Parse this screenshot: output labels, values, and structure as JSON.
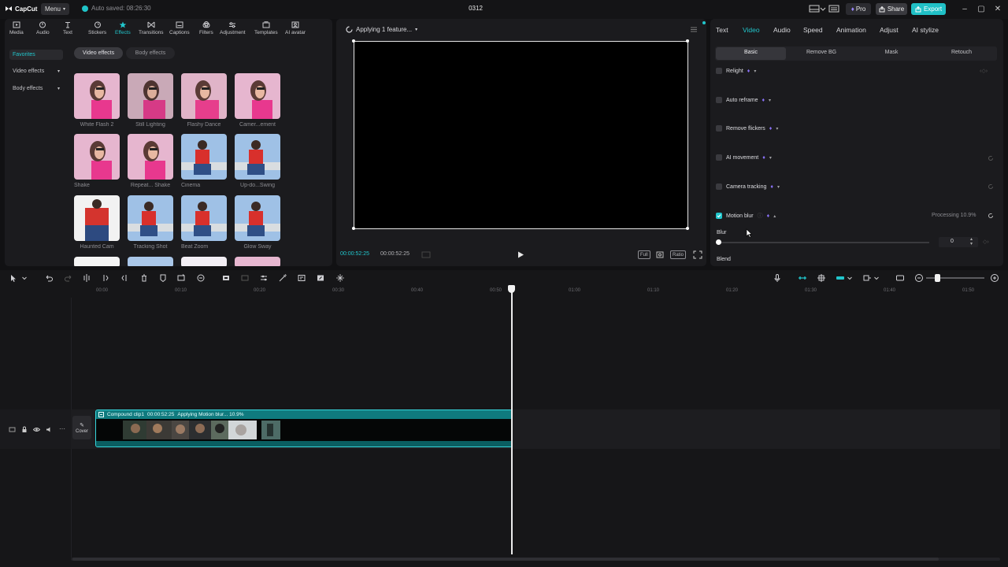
{
  "app": {
    "logo_text": "CapCut",
    "menu_label": "Menu",
    "autosave_text": "Auto saved: 08:26:30",
    "project_title": "0312",
    "pro_label": "Pro",
    "share_label": "Share",
    "export_label": "Export"
  },
  "toolbar": {
    "items": [
      {
        "label": "Media",
        "icon": "media-icon"
      },
      {
        "label": "Audio",
        "icon": "audio-icon"
      },
      {
        "label": "Text",
        "icon": "text-icon"
      },
      {
        "label": "Stickers",
        "icon": "stickers-icon"
      },
      {
        "label": "Effects",
        "icon": "effects-icon"
      },
      {
        "label": "Transitions",
        "icon": "transitions-icon"
      },
      {
        "label": "Captions",
        "icon": "captions-icon"
      },
      {
        "label": "Filters",
        "icon": "filters-icon"
      },
      {
        "label": "Adjustment",
        "icon": "adjustment-icon"
      },
      {
        "label": "Templates",
        "icon": "templates-icon"
      },
      {
        "label": "AI avatar",
        "icon": "ai-avatar-icon"
      }
    ],
    "active": "Effects"
  },
  "sidebar": {
    "favorites": "Favorites",
    "video_effects": "Video effects",
    "body_effects": "Body effects"
  },
  "effect_tabs": {
    "video": "Video effects",
    "body": "Body effects"
  },
  "effects": [
    {
      "label": "White Flash 2"
    },
    {
      "label": "Still Lighting"
    },
    {
      "label": "Flashy Dance"
    },
    {
      "label": "Camer...ement"
    },
    {
      "label": "Shake"
    },
    {
      "label": "Repeat... Shake"
    },
    {
      "label": "Cinema"
    },
    {
      "label": "Up-do...Swing"
    },
    {
      "label": "Haunted Cam"
    },
    {
      "label": "Tracking Shot"
    },
    {
      "label": "Beat Zoom"
    },
    {
      "label": "Glow Sway"
    }
  ],
  "player": {
    "status": "Applying 1 feature...",
    "current_time": "00:00:52:25",
    "total_time": "00:00:52:25",
    "full_label": "Full",
    "ratio_label": "Ratio"
  },
  "inspector": {
    "tabs": [
      "Text",
      "Video",
      "Audio",
      "Speed",
      "Animation",
      "Adjust",
      "AI stylize"
    ],
    "active_tab": "Video",
    "subtabs": [
      "Basic",
      "Remove BG",
      "Mask",
      "Retouch"
    ],
    "active_subtab": "Basic",
    "features": [
      {
        "label": "Relight",
        "checked": false
      },
      {
        "label": "Auto reframe",
        "checked": false
      },
      {
        "label": "Remove flickers",
        "checked": false
      },
      {
        "label": "AI movement",
        "checked": false
      },
      {
        "label": "Camera tracking",
        "checked": false
      },
      {
        "label": "Motion blur",
        "checked": true
      }
    ],
    "processing_text": "Processing 10.9%",
    "blur_label": "Blur",
    "blur_value": "0",
    "blend_label": "Blend"
  },
  "timeline": {
    "ruler": [
      "00:00",
      "00:10",
      "00:20",
      "00:30",
      "00:40",
      "00:50",
      "01:00",
      "01:10",
      "01:20",
      "01:30",
      "01:40",
      "01:50"
    ],
    "cover_label": "Cover",
    "clip_label": "Compound clip1",
    "clip_duration": "00:00:52:25",
    "clip_status": "Applying Motion blur... 10.9%"
  },
  "colors": {
    "accent": "#21c6cc",
    "clip": "#0d6f73",
    "premium_gem": "#8a72f7"
  }
}
